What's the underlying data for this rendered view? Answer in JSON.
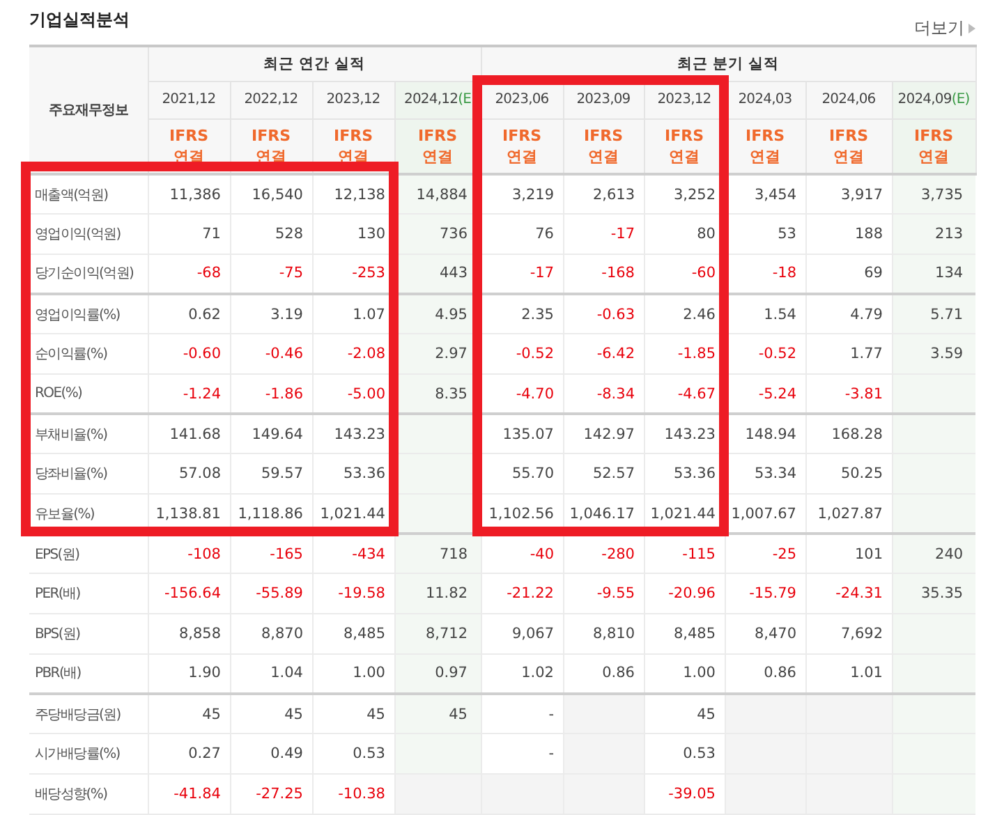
{
  "title": "기업실적분석",
  "more_link": "더보기",
  "row_header": "주요재무정보",
  "sections": [
    {
      "title": "최근 연간 실적",
      "framed": true,
      "columns": [
        {
          "date": "2021,12",
          "basis": "IFRS",
          "consolidation": "연결"
        },
        {
          "date": "2022,12",
          "basis": "IFRS",
          "consolidation": "연결"
        },
        {
          "date": "2023,12",
          "basis": "IFRS",
          "consolidation": "연결"
        },
        {
          "date": "2024,12",
          "suffix": "(E",
          "basis": "IFRS",
          "consolidation": "연결"
        }
      ]
    },
    {
      "title": "최근 분기 실적",
      "framed": true,
      "columns": [
        {
          "date": "2023,06",
          "basis": "IFRS",
          "consolidation": "연결"
        },
        {
          "date": "2023,09",
          "basis": "IFRS",
          "consolidation": "연결"
        },
        {
          "date": "2023,12",
          "basis": "IFRS",
          "consolidation": "연결"
        },
        {
          "date": "2024,03",
          "basis": "IFRS",
          "consolidation": "연결"
        },
        {
          "date": "2024,06",
          "basis": "IFRS",
          "consolidation": "연결"
        },
        {
          "date": "2024,09",
          "suffix": "(E)",
          "basis": "IFRS",
          "consolidation": "연결"
        }
      ]
    }
  ],
  "groups": [
    {
      "rows": [
        {
          "label": "매출액(억원)",
          "cells": [
            "11,386",
            "16,540",
            "12,138",
            "14,884",
            "3,219",
            "2,613",
            "3,252",
            "3,454",
            "3,917",
            "3,735"
          ]
        },
        {
          "label": "영업이익(억원)",
          "cells": [
            "71",
            "528",
            "130",
            "736",
            "76",
            "-17",
            "80",
            "53",
            "188",
            "213"
          ]
        },
        {
          "label": "당기순이익(억원)",
          "cells": [
            "-68",
            "-75",
            "-253",
            "443",
            "-17",
            "-168",
            "-60",
            "-18",
            "69",
            "134"
          ]
        }
      ]
    },
    {
      "rows": [
        {
          "label": "영업이익률(%)",
          "cells": [
            "0.62",
            "3.19",
            "1.07",
            "4.95",
            "2.35",
            "-0.63",
            "2.46",
            "1.54",
            "4.79",
            "5.71"
          ]
        },
        {
          "label": "순이익률(%)",
          "cells": [
            "-0.60",
            "-0.46",
            "-2.08",
            "2.97",
            "-0.52",
            "-6.42",
            "-1.85",
            "-0.52",
            "1.77",
            "3.59"
          ]
        },
        {
          "label": "ROE(%)",
          "cells": [
            "-1.24",
            "-1.86",
            "-5.00",
            "8.35",
            "-4.70",
            "-8.34",
            "-4.67",
            "-5.24",
            "-3.81",
            null
          ]
        }
      ]
    },
    {
      "rows": [
        {
          "label": "부채비율(%)",
          "cells": [
            "141.68",
            "149.64",
            "143.23",
            null,
            "135.07",
            "142.97",
            "143.23",
            "148.94",
            "168.28",
            null
          ]
        },
        {
          "label": "당좌비율(%)",
          "cells": [
            "57.08",
            "59.57",
            "53.36",
            null,
            "55.70",
            "52.57",
            "53.36",
            "53.34",
            "50.25",
            null
          ]
        },
        {
          "label": "유보율(%)",
          "cells": [
            "1,138.81",
            "1,118.86",
            "1,021.44",
            null,
            "1,102.56",
            "1,046.17",
            "1,021.44",
            "1,007.67",
            "1,027.87",
            null
          ]
        }
      ]
    },
    {
      "rows": [
        {
          "label": "EPS(원)",
          "cells": [
            "-108",
            "-165",
            "-434",
            "718",
            "-40",
            "-280",
            "-115",
            "-25",
            "101",
            "240"
          ]
        },
        {
          "label": "PER(배)",
          "cells": [
            "-156.64",
            "-55.89",
            "-19.58",
            "11.82",
            "-21.22",
            "-9.55",
            "-20.96",
            "-15.79",
            "-24.31",
            "35.35"
          ]
        },
        {
          "label": "BPS(원)",
          "cells": [
            "8,858",
            "8,870",
            "8,485",
            "8,712",
            "9,067",
            "8,810",
            "8,485",
            "8,470",
            "7,692",
            null
          ]
        },
        {
          "label": "PBR(배)",
          "cells": [
            "1.90",
            "1.04",
            "1.00",
            "0.97",
            "1.02",
            "0.86",
            "1.00",
            "0.86",
            "1.01",
            null
          ]
        }
      ]
    },
    {
      "rows": [
        {
          "label": "주당배당금(원)",
          "cells": [
            "45",
            "45",
            "45",
            "45",
            "-",
            {
              "kind": "unavailable"
            },
            "45",
            {
              "kind": "unavailable"
            },
            {
              "kind": "unavailable"
            },
            null
          ]
        },
        {
          "label": "시가배당률(%)",
          "cells": [
            "0.27",
            "0.49",
            "0.53",
            null,
            "-",
            {
              "kind": "unavailable"
            },
            "0.53",
            {
              "kind": "unavailable"
            },
            {
              "kind": "unavailable"
            },
            null
          ]
        },
        {
          "label": "배당성향(%)",
          "cells": [
            "-41.84",
            "-27.25",
            "-10.38",
            {
              "kind": "unavailable"
            },
            {
              "kind": "unavailable"
            },
            {
              "kind": "unavailable"
            },
            "-39.05",
            {
              "kind": "unavailable"
            },
            {
              "kind": "unavailable"
            },
            null
          ]
        }
      ]
    }
  ]
}
